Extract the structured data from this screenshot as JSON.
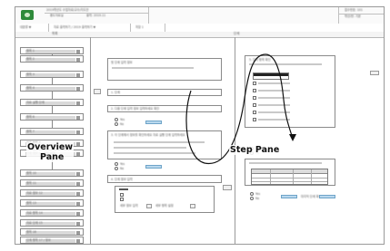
{
  "header": {
    "title_line1": "2019학년도 수업자료/교수/지도안",
    "title_line2": "중도자료실",
    "title_line3": "출력: 2019.11",
    "right_label1": "접수번호: 101",
    "right_label2": "학년/반: 기본",
    "sub_left": "대분류 ▼",
    "sub_mid": "자료 출력하기 / 2019 출력하기 ▼",
    "sub_right": "저장 1"
  },
  "columns": {
    "left_title": "목록",
    "right_title": "단계"
  },
  "sidebar": {
    "items": [
      {
        "label": "항목 1"
      },
      {
        "label": "항목 2"
      },
      {
        "label": "항목 3"
      },
      {
        "label": "항목 4"
      },
      {
        "label": "자료 실행 단계"
      },
      {
        "label": "항목 6"
      },
      {
        "label": "항목 7"
      },
      {
        "label": "자료 항목 8"
      },
      {
        "label": "단계 정보 1 / 항목 설정"
      },
      {
        "label": "항목 10"
      },
      {
        "label": "항목 11"
      },
      {
        "label": "자료 정보 12"
      },
      {
        "label": "항목 13"
      },
      {
        "label": "자료 항목 14"
      },
      {
        "label": "자료 단계 15"
      },
      {
        "label": "항목 16"
      },
      {
        "label": "단계 항목 17 / 정보"
      }
    ]
  },
  "steps": {
    "s1": "첫 단계 입력 정보",
    "s2": "1. 단계",
    "s3": "2. 다음 단계 입력 정보 입력하세요 확인",
    "s4": "3. 이 단계에서 정보를 확인하세요 자료 실행 단계 입력하세요",
    "s5": "4. 단계 정보 입력",
    "s6": "5. 입력 항목 확인",
    "yes": "Yes",
    "no": "No",
    "r1": "세부 정보 입력",
    "r2": "세부 항목 설정",
    "r3": "다음 단계 입력",
    "r4": "마지막 단계 확인"
  },
  "annotations": {
    "overview_line1": "Overview",
    "overview_line2": "Pane",
    "step_pane": "Step Pane"
  }
}
